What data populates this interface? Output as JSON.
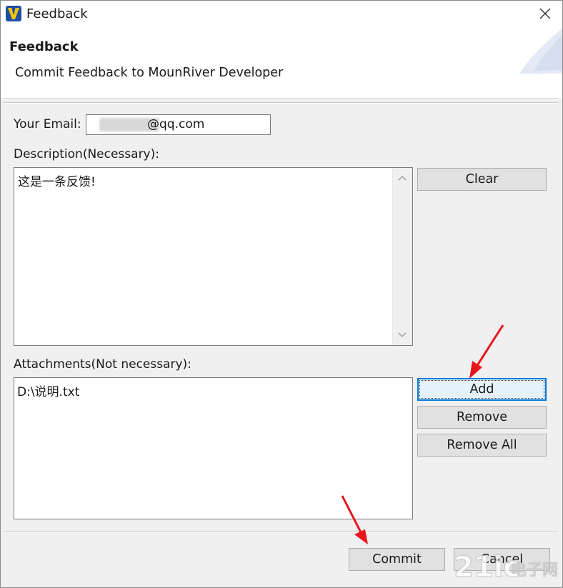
{
  "window": {
    "title": "Feedback"
  },
  "header": {
    "title": "Feedback",
    "subtitle": "Commit Feedback to MounRiver Developer"
  },
  "form": {
    "email_label": "Your Email:",
    "email_value": "@qq.com",
    "description_label": "Description(Necessary):",
    "description_value": "这是一条反馈!",
    "attachments_label": "Attachments(Not necessary):",
    "attachments": [
      "D:\\说明.txt"
    ]
  },
  "buttons": {
    "clear": "Clear",
    "add": "Add",
    "remove": "Remove",
    "remove_all": "Remove All",
    "commit": "Commit",
    "cancel": "Cancel"
  },
  "watermark": {
    "text": "21ic电子网"
  },
  "colors": {
    "annotation_arrow": "#e8141c",
    "focus_blue": "#0078d7",
    "app_icon_yellow": "#f5c400",
    "app_icon_blue": "#1f4fa3"
  },
  "icons": {
    "app": "mounriver-logo-icon",
    "close": "close-icon",
    "scroll_up": "chevron-up-icon",
    "scroll_down": "chevron-down-icon"
  }
}
